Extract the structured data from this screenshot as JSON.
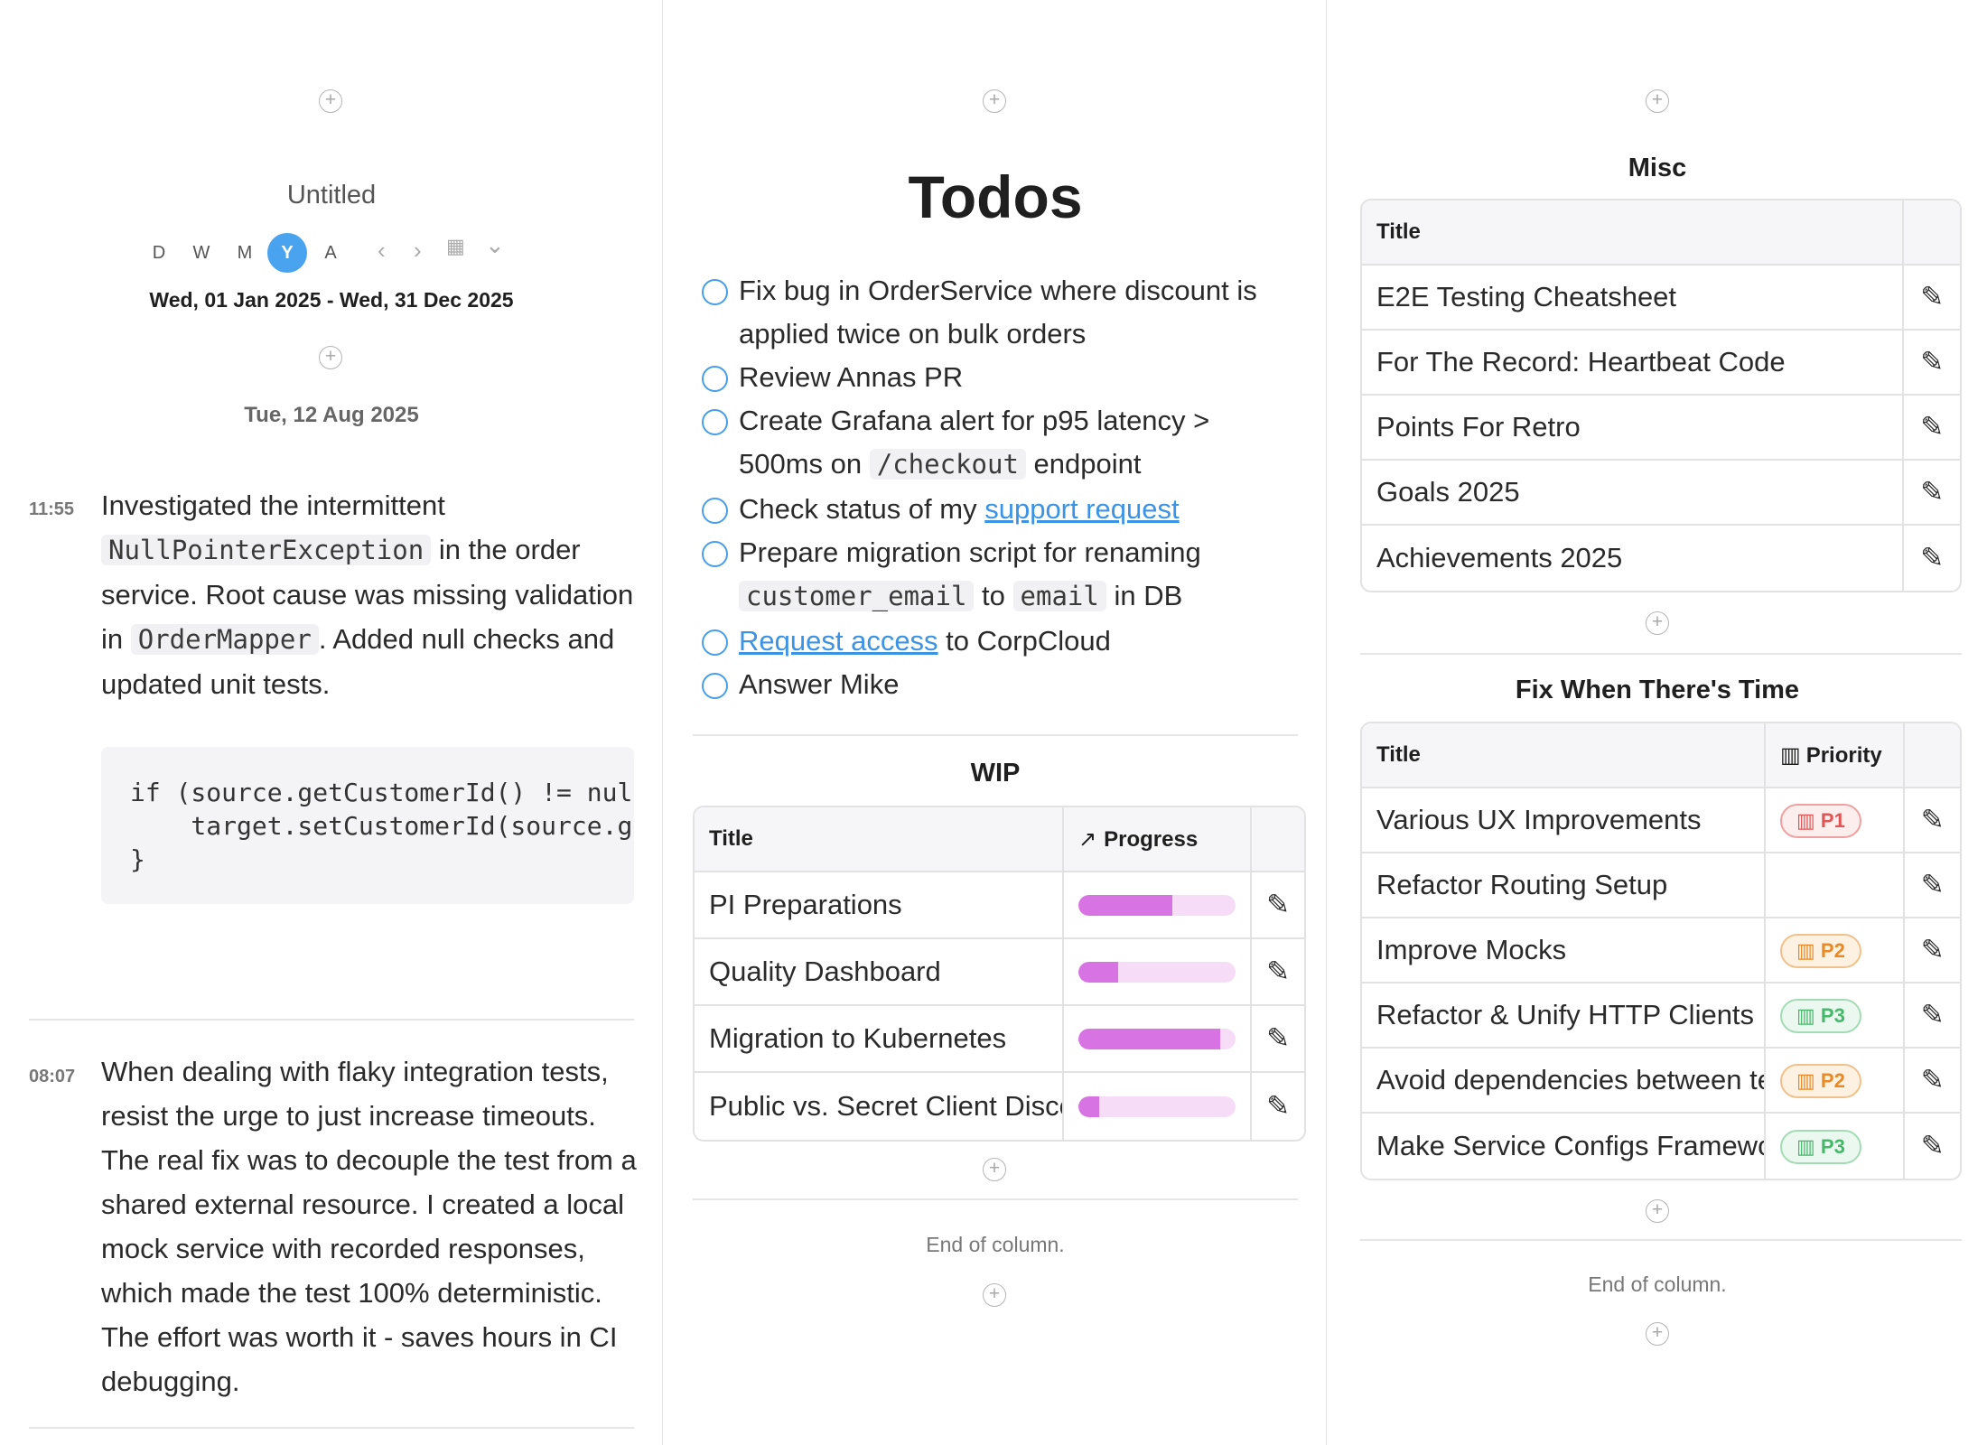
{
  "journal": {
    "add_symbol": "+",
    "title": "Untitled",
    "views": [
      {
        "label": "D",
        "active": false
      },
      {
        "label": "W",
        "active": false
      },
      {
        "label": "M",
        "active": false
      },
      {
        "label": "Y",
        "active": true
      },
      {
        "label": "A",
        "active": false
      }
    ],
    "icons": {
      "prev": "‹",
      "next": "›",
      "calendar": "▦",
      "dropdown": "⌄"
    },
    "date_range": "Wed, 01 Jan 2025 - Wed, 31 Dec 2025",
    "day_header": "Tue, 12 Aug 2025",
    "entries": [
      {
        "time": "11:55",
        "text_parts": [
          "Investigated the intermittent ",
          "NullPointerException",
          " in the order service. Root cause was missing validation in ",
          "OrderMapper",
          ". Added null checks and updated unit tests."
        ],
        "code": "if (source.getCustomerId() != null) {\n    target.setCustomerId(source.getCustomerId());\n}"
      },
      {
        "time": "08:07",
        "text": "When dealing with flaky integration tests, resist the urge to just increase timeouts. The real fix was to decouple the test from a shared external resource. I created a local mock service with recorded responses, which made the test 100% deterministic. The effort was worth it - saves hours in CI debugging."
      }
    ]
  },
  "todos": {
    "title": "Todos",
    "items": [
      {
        "parts": [
          "Fix bug in OrderService where discount is applied twice on bulk orders"
        ]
      },
      {
        "parts": [
          "Review Annas PR"
        ]
      },
      {
        "parts": [
          "Create Grafana alert for p95 latency > 500ms on ",
          "/checkout",
          " endpoint"
        ]
      },
      {
        "parts": [
          "Check status of my ",
          "support request"
        ]
      },
      {
        "parts": [
          "Prepare migration script for renaming ",
          "customer_email",
          " to ",
          "email",
          " in DB"
        ]
      },
      {
        "parts": [
          "Request access",
          " to CorpCloud"
        ]
      },
      {
        "parts": [
          "Answer Mike"
        ]
      }
    ],
    "wip": {
      "title": "WIP",
      "col_title": "Title",
      "col_progress": "Progress",
      "progress_icon": "↗",
      "rows": [
        {
          "title": "PI Preparations",
          "progress": 0.6
        },
        {
          "title": "Quality Dashboard",
          "progress": 0.25
        },
        {
          "title": "Migration to Kubernetes",
          "progress": 0.9
        },
        {
          "title": "Public vs. Secret Client Discovery",
          "progress": 0.13
        }
      ]
    },
    "end_text": "End of column."
  },
  "misc": {
    "title": "Misc",
    "col_title": "Title",
    "rows": [
      "E2E Testing Cheatsheet",
      "For The Record: Heartbeat Code",
      "Points For Retro",
      "Goals 2025",
      "Achievements 2025"
    ],
    "fix": {
      "title": "Fix When There's Time",
      "col_title": "Title",
      "col_priority": "Priority",
      "rows": [
        {
          "title": "Various UX Improvements",
          "priority": "P1"
        },
        {
          "title": "Refactor Routing Setup",
          "priority": ""
        },
        {
          "title": "Improve Mocks",
          "priority": "P2"
        },
        {
          "title": "Refactor & Unify HTTP Clients",
          "priority": "P3"
        },
        {
          "title": "Avoid dependencies between tests",
          "priority": "P2"
        },
        {
          "title": "Make Service Configs Framework Agnostic",
          "priority": "P3"
        }
      ]
    },
    "end_text": "End of column."
  },
  "colors": {
    "accent": "#4aa3ee",
    "progress_fill": "#d873e4",
    "progress_track": "#f7dcf7"
  }
}
